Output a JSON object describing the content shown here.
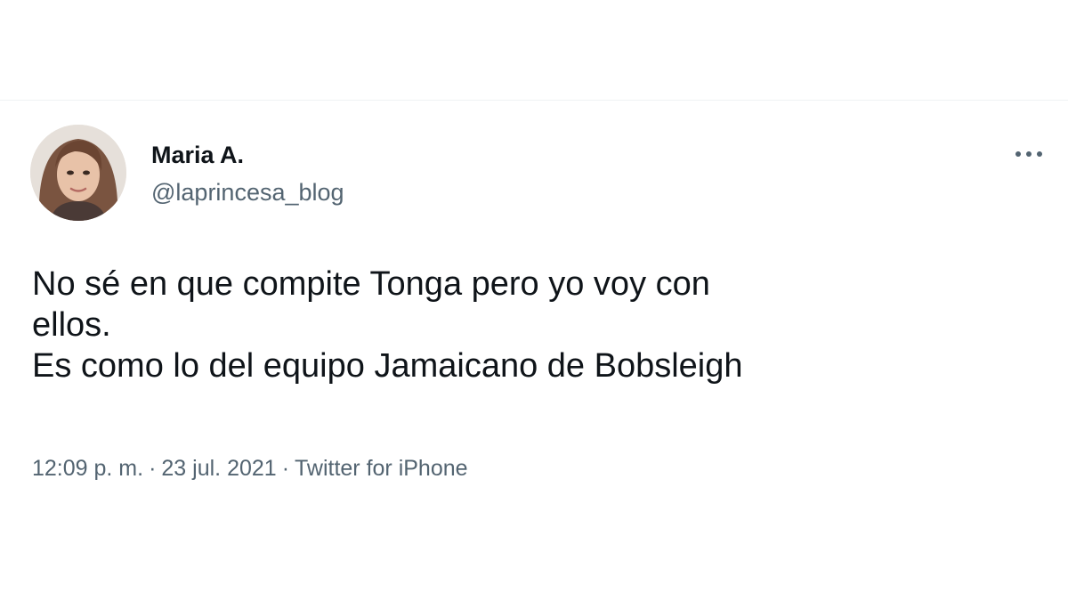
{
  "tweet": {
    "author": {
      "display_name": "Maria A.",
      "handle": "@laprincesa_blog"
    },
    "text_lines": [
      "No sé en que compite Tonga pero yo voy con",
      "ellos.",
      "Es como lo del equipo Jamaicano de Bobsleigh"
    ],
    "meta": {
      "time": "12:09 p. m.",
      "separator": "·",
      "date": "23 jul. 2021",
      "source": "Twitter for iPhone"
    },
    "icons": {
      "more": "more-horizontal-icon"
    }
  },
  "colors": {
    "text_primary": "#0f1419",
    "text_secondary": "#536471",
    "divider": "#eff3f4",
    "background": "#ffffff"
  }
}
